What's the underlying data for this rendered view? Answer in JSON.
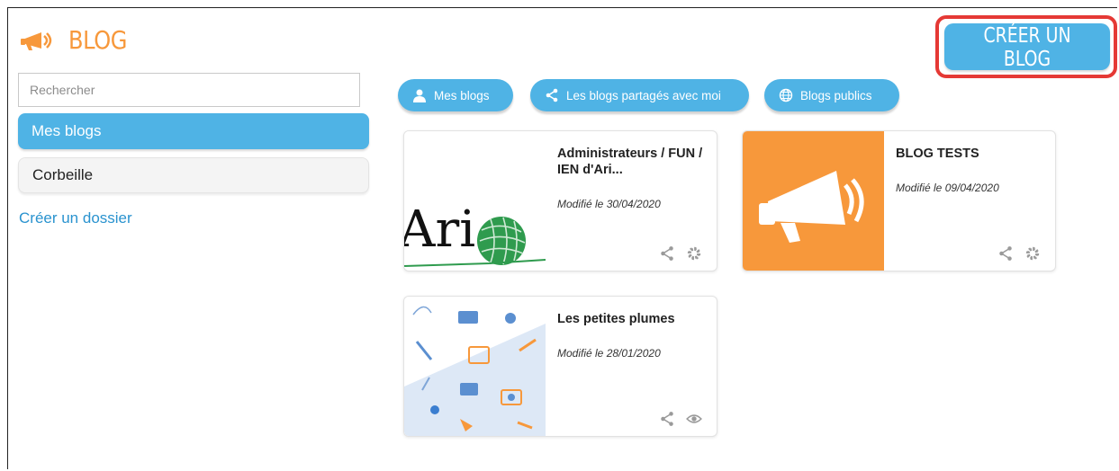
{
  "app": {
    "title": "BLOG",
    "accent_color": "#f7983b",
    "primary_color": "#4fb3e5"
  },
  "header": {
    "create_button": "CRÉER UN BLOG"
  },
  "sidebar": {
    "search_placeholder": "Rechercher",
    "items": [
      {
        "label": "Mes blogs",
        "active": true
      },
      {
        "label": "Corbeille",
        "active": false
      }
    ],
    "new_folder_link": "Créer un dossier"
  },
  "filters": [
    {
      "label": "Mes blogs",
      "icon": "user-icon"
    },
    {
      "label": "Les blogs partagés avec moi",
      "icon": "share-icon"
    },
    {
      "label": "Blogs publics",
      "icon": "globe-icon"
    }
  ],
  "blogs": [
    {
      "title": "Administrateurs / FUN / IEN d'Ari...",
      "modified": "Modifié le 30/04/2020",
      "thumb_text": "Ari",
      "actions": [
        "share-icon",
        "gear-icon"
      ]
    },
    {
      "title": "BLOG TESTS",
      "modified": "Modifié le 09/04/2020",
      "actions": [
        "share-icon",
        "gear-icon"
      ]
    },
    {
      "title": "Les petites plumes",
      "modified": "Modifié le 28/01/2020",
      "actions": [
        "share-icon",
        "eye-icon"
      ]
    }
  ]
}
